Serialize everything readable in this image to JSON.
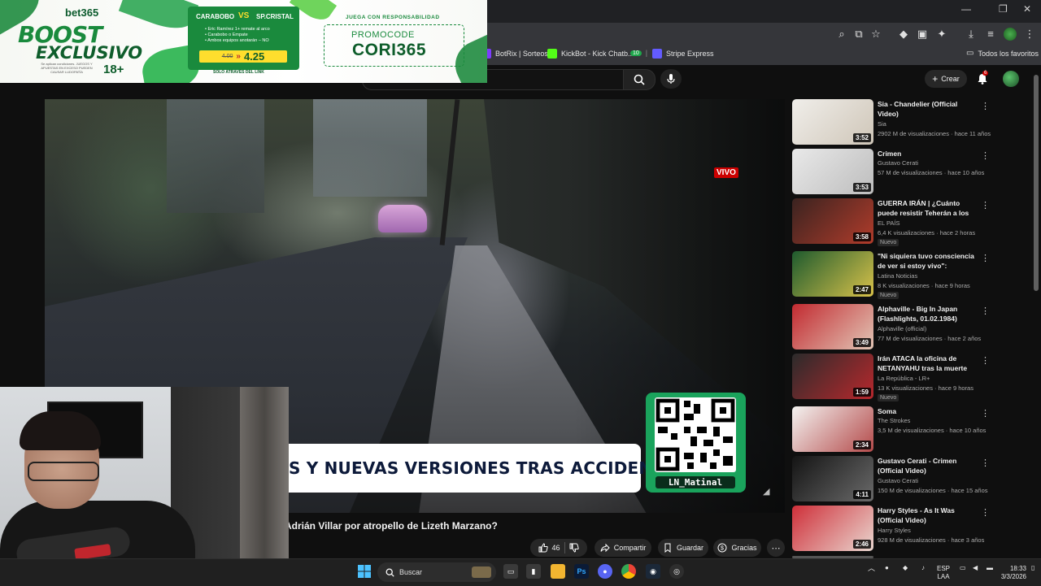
{
  "browser": {
    "window_controls": [
      "—",
      "❐",
      "✕"
    ],
    "bookmarks": [
      {
        "label": "BotRix | Sorteos",
        "icon": "botrix-icon"
      },
      {
        "label": "KickBot - Kick Chatb...",
        "icon": "kickbot-icon"
      },
      {
        "label": "10",
        "icon": "badge-icon"
      },
      {
        "label": "Stripe Express",
        "icon": "stripe-icon"
      }
    ],
    "all_bookmarks_label": "Todos los favoritos"
  },
  "youtube": {
    "create_label": "Crear",
    "notification_count": "6",
    "live_badge": "VIVO",
    "video_title": "Adrián Villar por atropello de Lizeth Marzano?",
    "lower_third_text": "S Y NUEVAS VERSIONES TRAS ACCIDENTE",
    "qr_label": "LN_Matinal",
    "actions": {
      "like_count": "46",
      "share_label": "Compartir",
      "save_label": "Guardar",
      "thanks_label": "Gracias"
    },
    "sidebar": [
      {
        "title": "Sia - Chandelier (Official Video)",
        "channel": "Sia",
        "meta": "2902 M de visualizaciones · hace 11 años",
        "duration": "3:52",
        "badge": "",
        "colors": [
          "#f0eeea",
          "#cfc6b8"
        ]
      },
      {
        "title": "Crimen",
        "channel": "Gustavo Cerati",
        "meta": "57 M de visualizaciones · hace 10 años",
        "duration": "3:53",
        "badge": "",
        "colors": [
          "#e9e9e9",
          "#bdbdbd"
        ]
      },
      {
        "title": "GUERRA IRÁN | ¿Cuánto puede resistir Teherán a los ataques ...",
        "channel": "EL PAÍS",
        "meta": "6,4 K visualizaciones · hace 2 horas",
        "duration": "3:58",
        "badge": "Nuevo",
        "colors": [
          "#3a2320",
          "#b13c2b"
        ]
      },
      {
        "title": "\"Ni siquiera tuvo consciencia de ver si estoy vivo\": Detienen a ...",
        "channel": "Latina Noticias",
        "meta": "8 K visualizaciones · hace 9 horas",
        "duration": "2:47",
        "badge": "Nuevo",
        "colors": [
          "#1e5a2e",
          "#d9c24a"
        ]
      },
      {
        "title": "Alphaville - Big In Japan (Flashlights, 01.02.1984)",
        "channel": "Alphaville (official)",
        "meta": "77 M de visualizaciones · hace 2 años",
        "duration": "3:49",
        "badge": "",
        "colors": [
          "#c22a30",
          "#e2c6b6"
        ]
      },
      {
        "title": "Irán ATACA la oficina de NETANYAHU tras la muerte de...",
        "channel": "La República - LR+",
        "meta": "13 K visualizaciones · hace 9 horas",
        "duration": "1:59",
        "badge": "Nuevo",
        "colors": [
          "#2b2b2b",
          "#b8282d"
        ]
      },
      {
        "title": "Soma",
        "channel": "The Strokes",
        "meta": "3,5 M de visualizaciones · hace 10 años",
        "duration": "2:34",
        "badge": "",
        "colors": [
          "#f4f3f1",
          "#b44a4a"
        ]
      },
      {
        "title": "Gustavo Cerati - Crimen (Official Video)",
        "channel": "Gustavo Cerati",
        "meta": "150 M de visualizaciones · hace 15 años",
        "duration": "4:11",
        "badge": "",
        "colors": [
          "#141414",
          "#6a6a6a"
        ]
      },
      {
        "title": "Harry Styles - As It Was (Official Video)",
        "channel": "Harry Styles",
        "meta": "928 M de visualizaciones · hace 3 años",
        "duration": "2:46",
        "badge": "",
        "colors": [
          "#cf2f39",
          "#e9d6cf"
        ]
      }
    ]
  },
  "ad": {
    "brand": "bet365",
    "headline_1": "BOOST",
    "headline_2": "EXCLUSIVO",
    "age": "18+",
    "small_print": "Se aplican condiciones. JUEGOS Y APUESTAS EN EXCESO PUEDEN CAUSAR LUDOPATÍA",
    "team_home": "CARABOBO",
    "vs": "VS",
    "team_away": "SP.CRISTAL",
    "bullets": [
      "• Eric Ramírez 1+ remate al arco",
      "• Carabobo o Empate",
      "• Ambos equipos anotarán – NO"
    ],
    "odds_old": "4.00",
    "odds_new": "4.25",
    "link_text": "SOLO ATRAVÉS DEL LINK",
    "responsible": "JUEGA CON RESPONSABILIDAD",
    "promo_label": "PROMOCODE",
    "promo_code": "CORI365"
  },
  "taskbar": {
    "search_placeholder": "Buscar",
    "lang_1": "ESP",
    "lang_2": "LAA",
    "time": "18:33",
    "date": "3/3/2026"
  }
}
